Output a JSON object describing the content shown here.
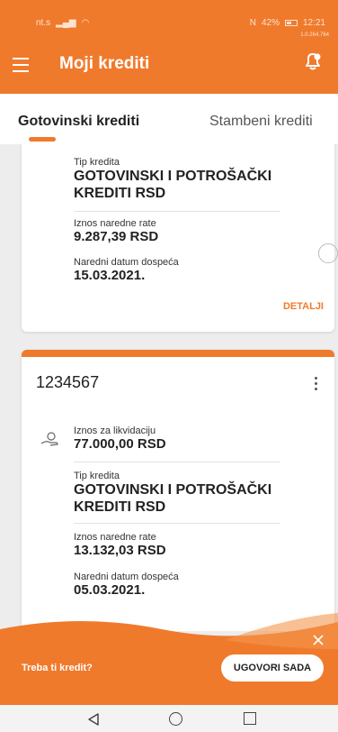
{
  "status": {
    "left": "nt.s",
    "battery": "42%",
    "time": "12:21",
    "speed": "1.0.264.764"
  },
  "app": {
    "title": "Moji krediti"
  },
  "tabs": [
    {
      "label": "Gotovinski krediti"
    },
    {
      "label": "Stambeni krediti"
    }
  ],
  "card1": {
    "type_label": "Tip kredita",
    "type_value": "GOTOVINSKI I POTROŠAČKI KREDITI RSD",
    "rate_label": "Iznos naredne rate",
    "rate_value": "9.287,39 RSD",
    "due_label": "Naredni datum dospeća",
    "due_value": "15.03.2021.",
    "details": "DETALJI"
  },
  "card2": {
    "number": "1234567",
    "liq_label": "Iznos za likvidaciju",
    "liq_value": "77.000,00 RSD",
    "type_label": "Tip kredita",
    "type_value": "GOTOVINSKI I POTROŠAČKI KREDITI RSD",
    "rate_label": "Iznos naredne rate",
    "rate_value": "13.132,03 RSD",
    "due_label": "Naredni datum dospeća",
    "due_value": "05.03.2021."
  },
  "promo": {
    "text": "Treba ti kredit?",
    "cta": "UGOVORI SADA"
  },
  "colors": {
    "accent": "#f07a2c"
  }
}
